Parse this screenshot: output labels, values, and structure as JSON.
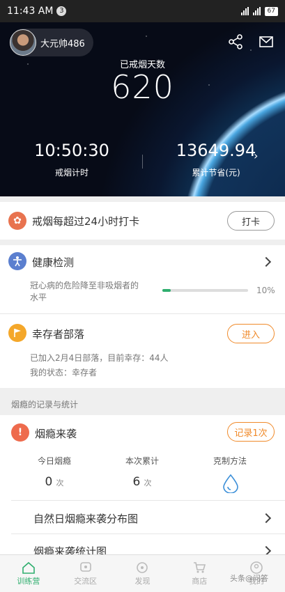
{
  "status_bar": {
    "time": "11:43 AM",
    "notification_count": "3",
    "battery": "67"
  },
  "hero": {
    "user_name": "大元帅486",
    "days_label": "已戒烟天数",
    "days_value": "620",
    "timer_value": "10:50:30",
    "timer_label": "戒烟计时",
    "saved_value": "13649.94",
    "saved_label": "累计节省(元)",
    "saved_arrow": "›"
  },
  "checkin": {
    "title": "戒烟每超过24小时打卡",
    "button": "打卡"
  },
  "health": {
    "title": "健康检测",
    "desc_line1": "冠心病的危险降至非吸烟者的",
    "desc_line2": "水平",
    "progress": 0.1,
    "progress_text": "10%",
    "progress_color": "#2fae6e"
  },
  "tribe": {
    "title": "幸存者部落",
    "button": "进入",
    "line1": "已加入2月4日部落，目前幸存：44人",
    "line2": "我的状态：幸存者"
  },
  "section_header": "烟瘾的记录与统计",
  "craving": {
    "title": "烟瘾来袭",
    "button": "记录1次",
    "stats": [
      {
        "label": "今日烟瘾",
        "value": "0",
        "unit": "次"
      },
      {
        "label": "本次累计",
        "value": "6",
        "unit": "次"
      },
      {
        "label": "克制方法",
        "value": "",
        "unit": ""
      }
    ],
    "links": [
      "自然日烟瘾来袭分布图",
      "烟瘾来袭统计图"
    ]
  },
  "nav": {
    "items": [
      {
        "label": "训练营",
        "icon": "home-icon",
        "active": true
      },
      {
        "label": "交流区",
        "icon": "chat-icon",
        "active": false
      },
      {
        "label": "发现",
        "icon": "compass-icon",
        "active": false
      },
      {
        "label": "商店",
        "icon": "cart-icon",
        "active": false
      },
      {
        "label": "我的",
        "icon": "user-icon",
        "active": false
      }
    ]
  },
  "watermark": "头条@问答",
  "colors": {
    "accent_orange": "#f08a2a",
    "accent_green": "#2fae6e",
    "checkin_icon": "#e8734f",
    "health_icon": "#5b7fcf",
    "tribe_icon": "#f4a72a",
    "craving_icon": "#ee6b4d"
  }
}
